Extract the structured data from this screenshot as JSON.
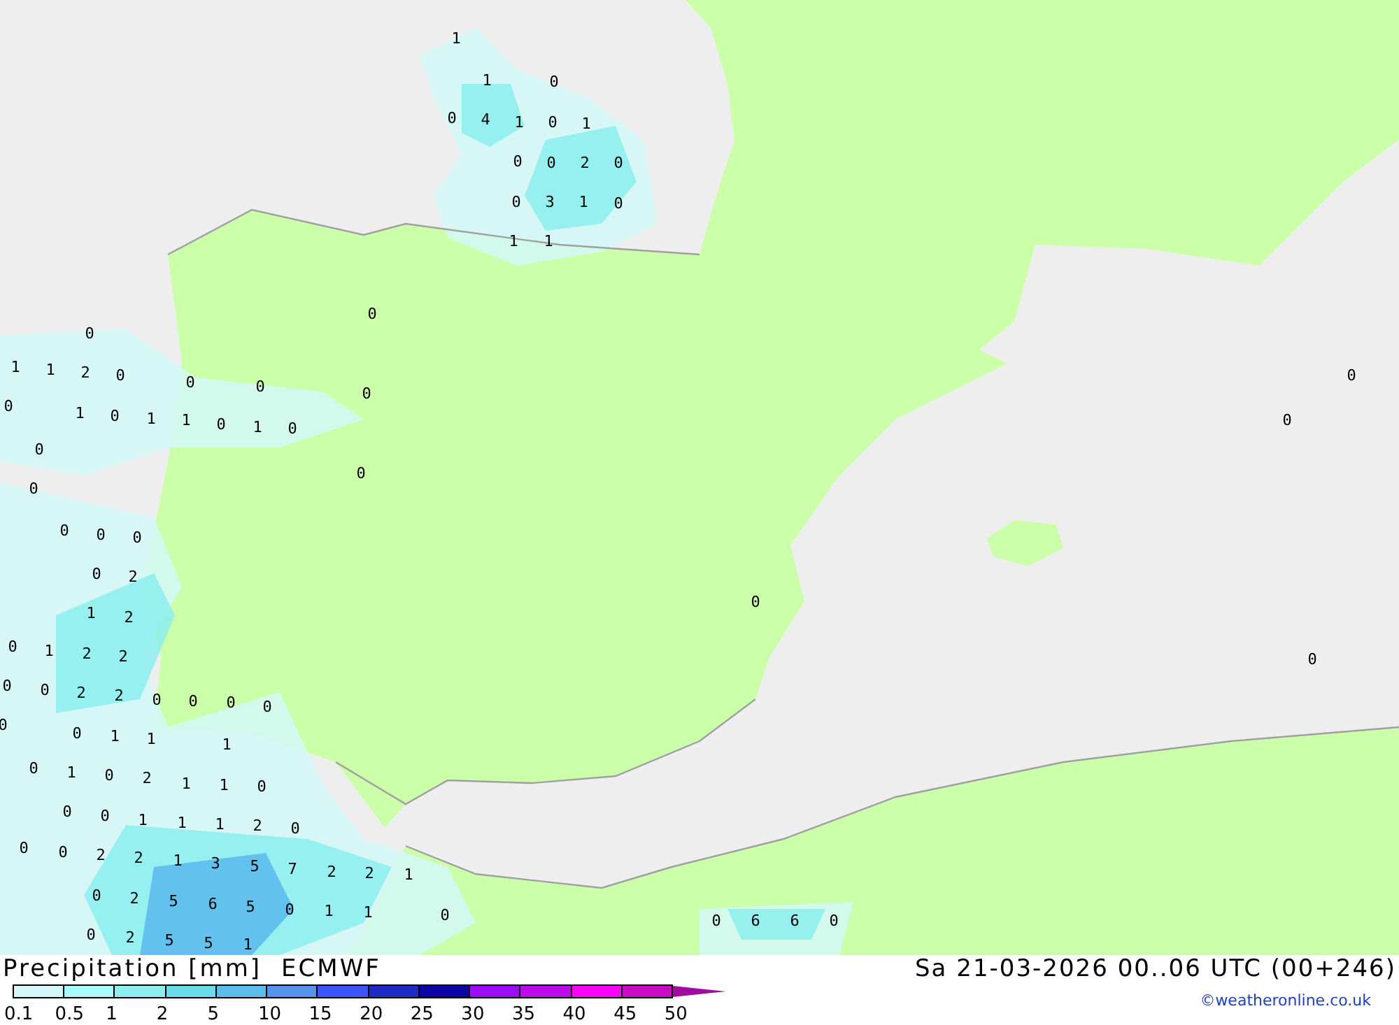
{
  "map": {
    "labels": [
      "1",
      "1",
      "0",
      "0",
      "4",
      "1",
      "0",
      "1",
      "0",
      "0",
      "2",
      "0",
      "0",
      "3",
      "1",
      "0",
      "1",
      "1",
      "0",
      "0",
      "1",
      "1",
      "2",
      "0",
      "0",
      "0",
      "0",
      "0",
      "1",
      "0",
      "1",
      "1",
      "0",
      "1",
      "0",
      "0",
      "0",
      "0",
      "0",
      "0",
      "0",
      "0",
      "2",
      "1",
      "2",
      "0",
      "1",
      "2",
      "2",
      "0",
      "0",
      "2",
      "2",
      "0",
      "0",
      "0",
      "0",
      "0",
      "0",
      "1",
      "1",
      "1",
      "0",
      "1",
      "0",
      "2",
      "1",
      "1",
      "0",
      "0",
      "0",
      "1",
      "1",
      "1",
      "2",
      "0",
      "0",
      "0",
      "2",
      "2",
      "1",
      "3",
      "5",
      "7",
      "2",
      "2",
      "1",
      "0",
      "2",
      "5",
      "6",
      "5",
      "0",
      "1",
      "1",
      "0",
      "0",
      "2",
      "5",
      "5",
      "1",
      "0",
      "6",
      "6",
      "0",
      "0",
      "0",
      "0",
      "0"
    ]
  },
  "legend": {
    "title": "Precipitation [mm]",
    "model": "ECMWF",
    "segments": [
      {
        "color": "#d2f8f8"
      },
      {
        "color": "#a8fcfc"
      },
      {
        "color": "#8ceeee"
      },
      {
        "color": "#6cdcec"
      },
      {
        "color": "#5cbcec"
      },
      {
        "color": "#5494ec"
      },
      {
        "color": "#3c54fc"
      },
      {
        "color": "#1c2cc4"
      },
      {
        "color": "#0c04a4"
      },
      {
        "color": "#9c0cfc"
      },
      {
        "color": "#bc0cec"
      },
      {
        "color": "#fc04fc"
      },
      {
        "color": "#cc0cc4"
      },
      {
        "color": "#a00ca0",
        "kind": "arrow"
      }
    ],
    "ticks": [
      "0.1",
      "0.5",
      "1",
      "2",
      "5",
      "10",
      "15",
      "20",
      "25",
      "30",
      "35",
      "40",
      "45",
      "50"
    ]
  },
  "valid_time": "Sa 21-03-2026 00..06 UTC (00+246)",
  "copyright": "©weatheronline.co.uk"
}
